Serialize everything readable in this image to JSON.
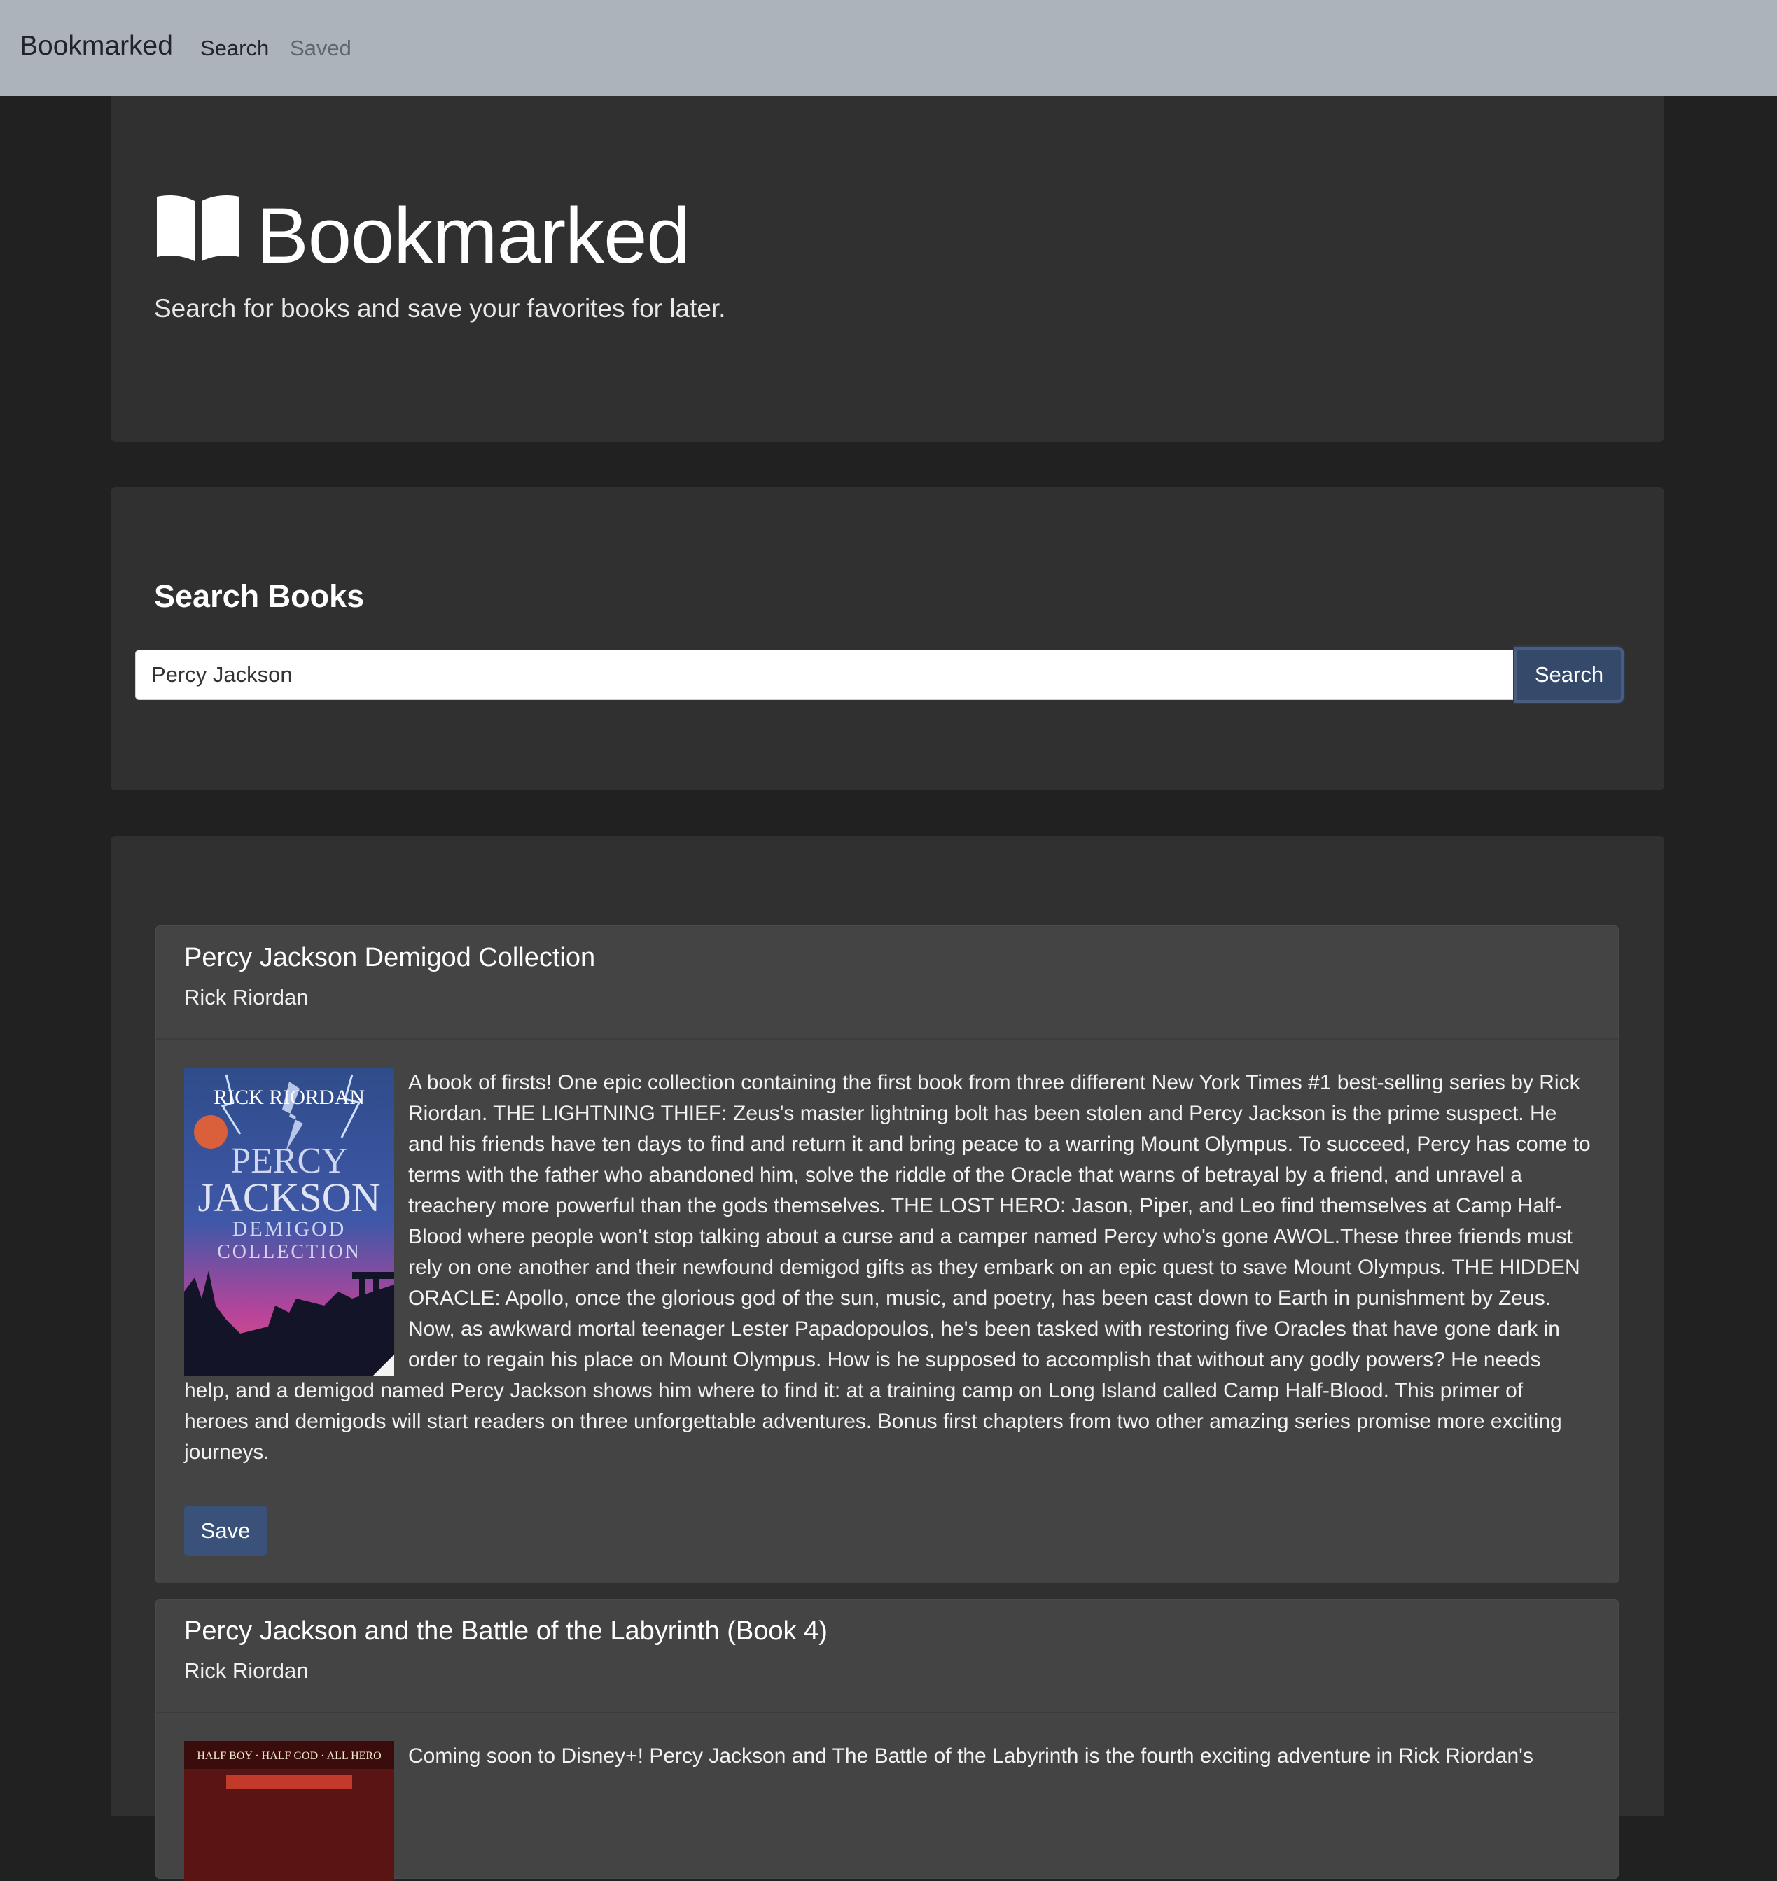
{
  "navbar": {
    "brand": "Bookmarked",
    "links": [
      "Search",
      "Saved"
    ]
  },
  "hero": {
    "title": "Bookmarked",
    "subtitle": "Search for books and save your favorites for later."
  },
  "search": {
    "heading": "Search Books",
    "query": "Percy Jackson",
    "button_label": "Search"
  },
  "results": [
    {
      "title": "Percy Jackson Demigod Collection",
      "author": "Rick Riordan",
      "cover": {
        "author_line": "RICK RIORDAN",
        "title_line1": "PERCY",
        "title_line2": "JACKSON",
        "title_line3": "DEMIGOD",
        "title_line4": "COLLECTION"
      },
      "description": "A book of firsts! One epic collection containing the first book from three different New York Times #1 best-selling series by Rick Riordan. THE LIGHTNING THIEF: Zeus's master lightning bolt has been stolen and Percy Jackson is the prime suspect. He and his friends have ten days to find and return it and bring peace to a warring Mount Olympus. To succeed, Percy has come to terms with the father who abandoned him, solve the riddle of the Oracle that warns of betrayal by a friend, and unravel a treachery more powerful than the gods themselves. THE LOST HERO: Jason, Piper, and Leo find themselves at Camp Half-Blood where people won't stop talking about a curse and a camper named Percy who's gone AWOL.These three friends must rely on one another and their newfound demigod gifts as they embark on an epic quest to save Mount Olympus. THE HIDDEN ORACLE: Apollo, once the glorious god of the sun, music, and poetry, has been cast down to Earth in punishment by Zeus. Now, as awkward mortal teenager Lester Papadopoulos, he's been tasked with restoring five Oracles that have gone dark in order to regain his place on Mount Olympus. How is he supposed to accomplish that without any godly powers? He needs help, and a demigod named Percy Jackson shows him where to find it: at a training camp on Long Island called Camp Half-Blood. This primer of heroes and demigods will start readers on three unforgettable adventures. Bonus first chapters from two other amazing series promise more exciting journeys.",
      "save_label": "Save"
    },
    {
      "title": "Percy Jackson and the Battle of the Labyrinth (Book 4)",
      "author": "Rick Riordan",
      "cover": {
        "tagline": "HALF BOY · HALF GOD · ALL HERO"
      },
      "description": "Coming soon to Disney+! Percy Jackson and The Battle of the Labyrinth is the fourth exciting adventure in Rick Riordan's"
    }
  ],
  "colors": {
    "navbar_bg": "#adb3bb",
    "page_bg": "#212121",
    "panel_bg": "#303030",
    "card_bg": "#444444",
    "primary_button": "#3a5279"
  }
}
